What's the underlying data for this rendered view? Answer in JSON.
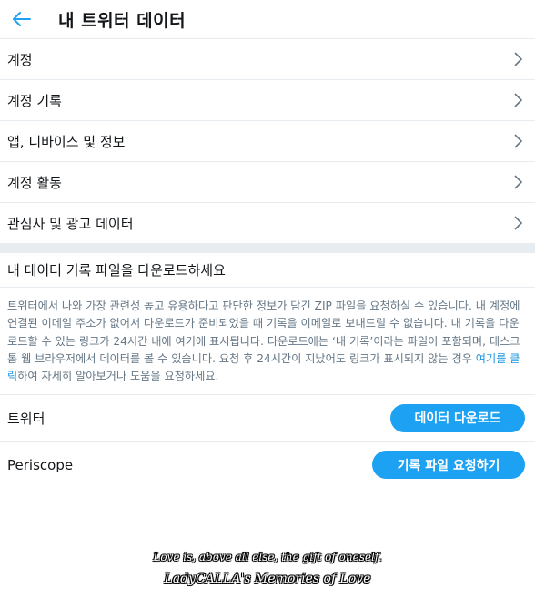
{
  "header": {
    "title": "내 트위터 데이터",
    "back_icon": "arrow-left-icon",
    "accent_color": "#1da1f2"
  },
  "menu": {
    "items": [
      {
        "label": "계정"
      },
      {
        "label": "계정 기록"
      },
      {
        "label": "앱, 디바이스 및 정보"
      },
      {
        "label": "계정 활동"
      },
      {
        "label": "관심사 및 광고 데이터"
      }
    ],
    "chevron_icon": "chevron-right-icon"
  },
  "download": {
    "heading": "내 데이터 기록 파일을 다운로드하세요",
    "description_before": "트위터에서 나와 가장 관련성 높고 유용하다고 판단한 정보가 담긴 ZIP 파일을 요청하실 수 있습니다. 내 계정에 연결된 이메일 주소가 없어서 다운로드가 준비되었을 때 기록을 이메일로 보내드릴 수 없습니다. 내 기록을 다운로드할 수 있는 링크가 24시간 내에 여기에 표시됩니다. 다운로드에는 ‘내 기록’이라는 파일이 포함되며, 데스크톱 웹 브라우저에서 데이터를 볼 수 있습니다. 요청 후 24시간이 지났어도 링크가 표시되지 않는 경우 ",
    "description_link": "여기를 클릭",
    "description_after": "하여 자세히 알아보거나 도움을 요청하세요.",
    "rows": [
      {
        "label": "트위터",
        "button": "데이터 다운로드"
      },
      {
        "label": "Periscope",
        "button": "기록 파일 요청하기"
      }
    ]
  },
  "watermark": {
    "line1": "Love is, above all else, the gift of oneself.",
    "line2": "LadyCALLA's Memories of Love"
  }
}
